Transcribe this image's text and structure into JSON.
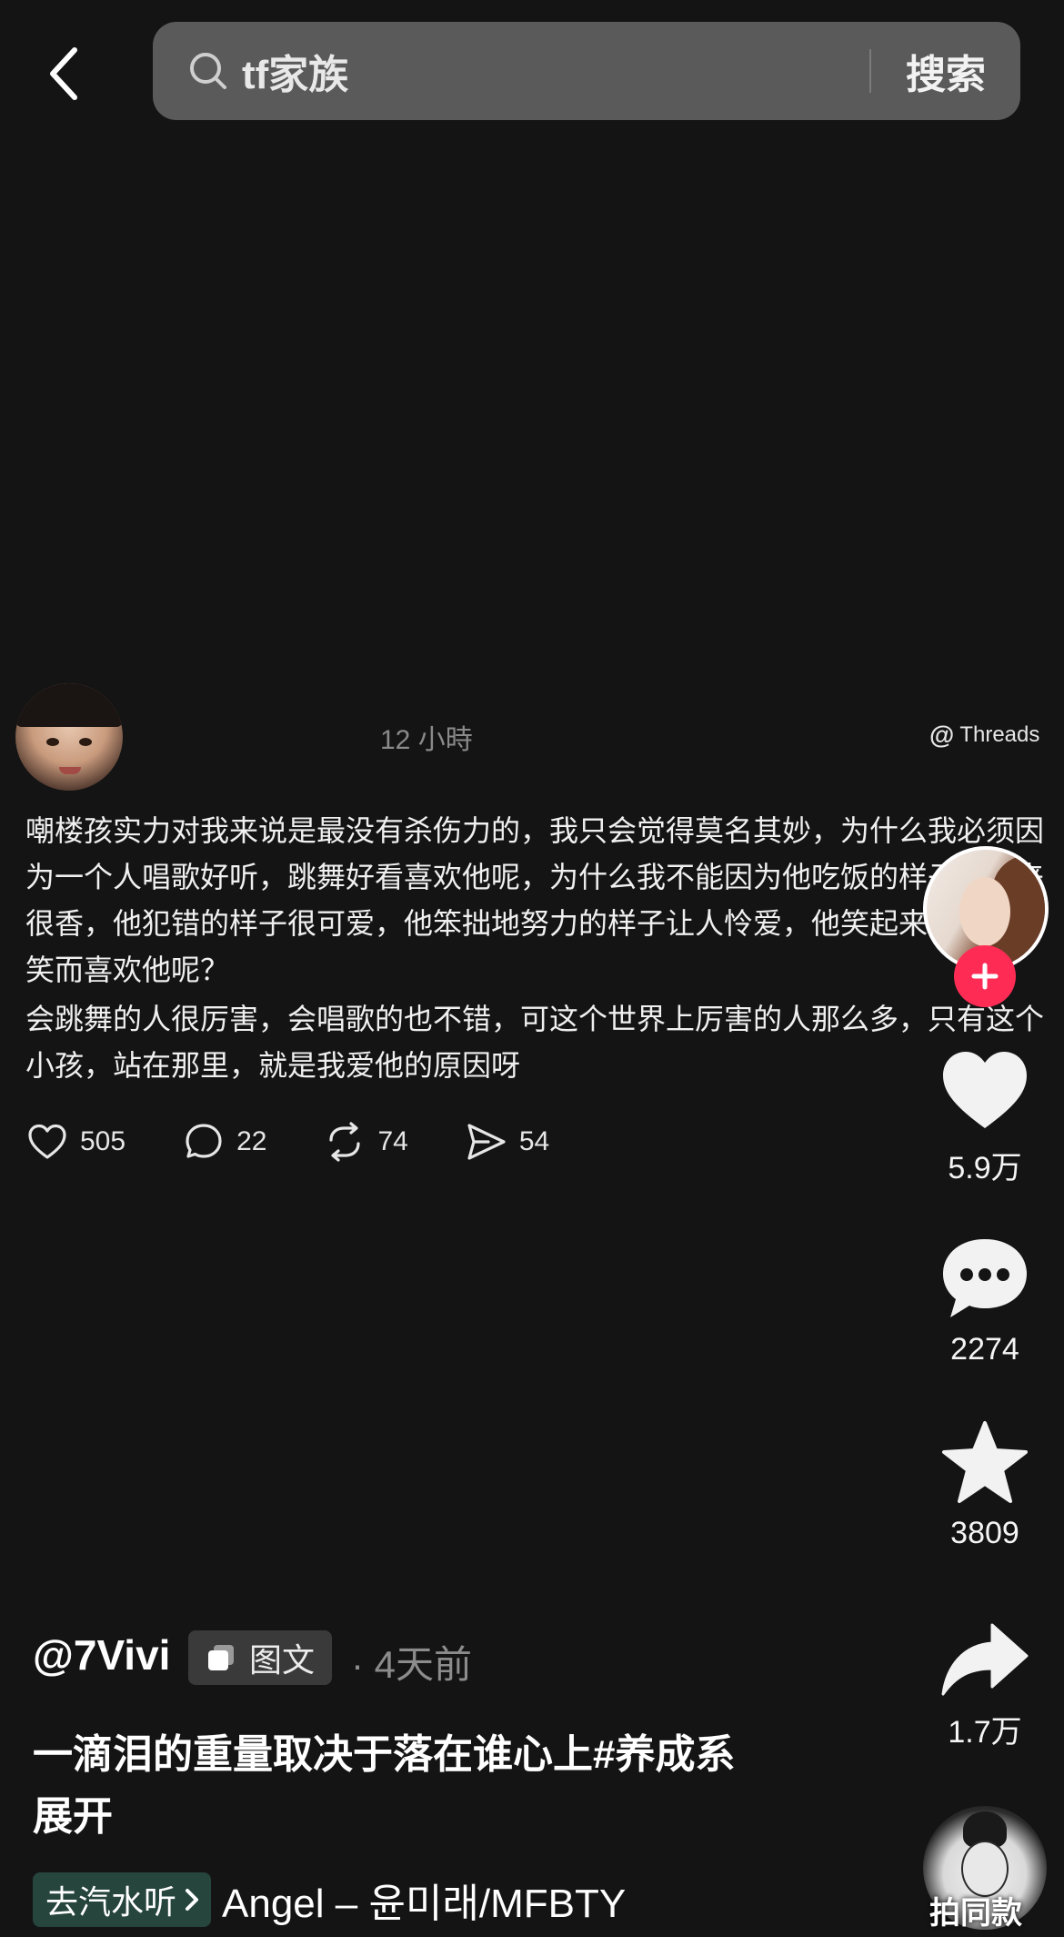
{
  "search": {
    "query": "tf家族",
    "button_label": "搜索"
  },
  "card": {
    "time": "12 小時",
    "source": "Threads",
    "paragraphs": [
      "嘲楼孩实力对我来说是最没有杀伤力的，我只会觉得莫名其妙，为什么我必须因为一个人唱歌好听，跳舞好看喜欢他呢，为什么我不能因为他吃饭的样子看起来很香，他犯错的样子很可爱，他笨拙地努力的样子让人怜爱，他笑起来我就也想笑而喜欢他呢？",
      "会跳舞的人很厉害，会唱歌的也不错，可这个世界上厉害的人那么多，只有这个小孩，站在那里，就是我爱他的原因呀"
    ],
    "stats": {
      "likes": "505",
      "comments": "22",
      "reposts": "74",
      "shares": "54"
    }
  },
  "sidebar": {
    "likes": "5.9万",
    "comments": "2274",
    "favorites": "3809",
    "shares": "1.7万",
    "shoot_same": "拍同款"
  },
  "post": {
    "username": "@7Vivi",
    "type_label": "图文",
    "date": "· 4天前",
    "caption": "一滴泪的重量取决于落在谁心上#养成系",
    "expand_label": "展开"
  },
  "music": {
    "chip_label": "去汽水听",
    "title": "Angel – 윤미래/MFBTY"
  },
  "colors": {
    "background": "#141414",
    "search_bg": "#5a5a5a",
    "follow_red": "#fe2c55",
    "music_chip": "#26453c"
  }
}
